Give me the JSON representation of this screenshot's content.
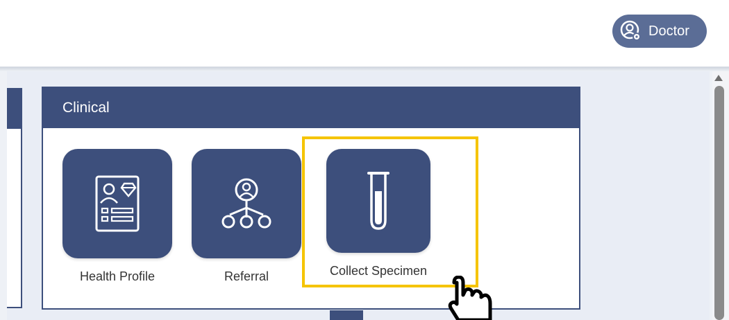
{
  "header": {
    "user_role": "Doctor"
  },
  "panel": {
    "title": "Clinical",
    "tiles": [
      {
        "label": "Health Profile",
        "icon": "health-profile-icon"
      },
      {
        "label": "Referral",
        "icon": "referral-icon"
      },
      {
        "label": "Collect Specimen",
        "icon": "test-tube-icon"
      }
    ]
  },
  "colors": {
    "panel_header": "#3d4f7c",
    "tile": "#3d4f7c",
    "highlight": "#f5c400",
    "role_button": "#5b6d96"
  }
}
